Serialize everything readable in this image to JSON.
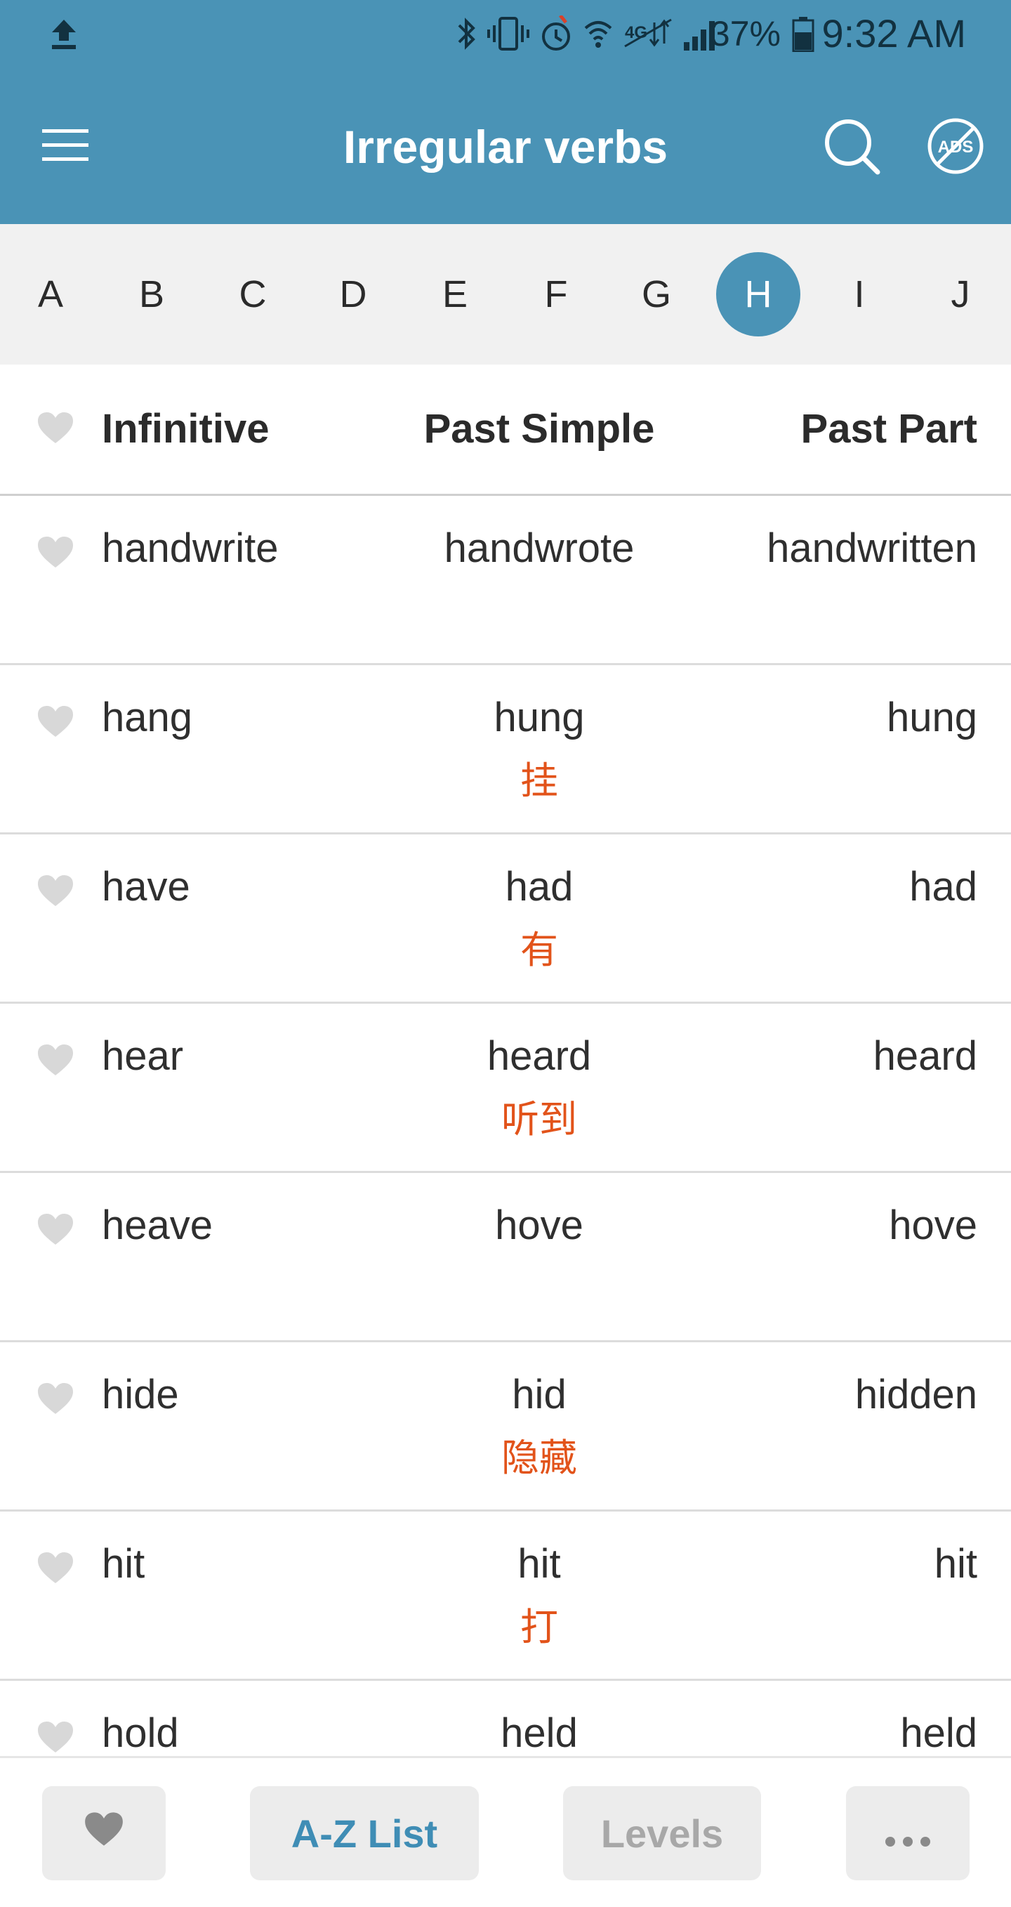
{
  "status_bar": {
    "upload_icon": "upload-arrow-icon",
    "icons": [
      "bluetooth-icon",
      "vibrate-icon",
      "alarm-icon",
      "wifi-icon",
      "lte-icon",
      "signal-icon"
    ],
    "battery_percent": "37%",
    "time": "9:32 AM"
  },
  "app_bar": {
    "title": "Irregular verbs",
    "menu_icon": "hamburger-menu-icon",
    "search_icon": "search-icon",
    "no_ads_icon": "no-ads-icon",
    "no_ads_text": "ADS",
    "background": "#4a93b6"
  },
  "alphabet": {
    "letters": [
      "A",
      "B",
      "C",
      "D",
      "E",
      "F",
      "G",
      "H",
      "I",
      "J"
    ],
    "selected": "H"
  },
  "table": {
    "headers": {
      "infinitive": "Infinitive",
      "past_simple": "Past Simple",
      "past_participle": "Past Part"
    },
    "rows": [
      {
        "infinitive": "handwrite",
        "past_simple": "handwrote",
        "past_participle": "handwritten",
        "translation": ""
      },
      {
        "infinitive": "hang",
        "past_simple": "hung",
        "past_participle": "hung",
        "translation": "挂"
      },
      {
        "infinitive": "have",
        "past_simple": "had",
        "past_participle": "had",
        "translation": "有"
      },
      {
        "infinitive": "hear",
        "past_simple": "heard",
        "past_participle": "heard",
        "translation": "听到"
      },
      {
        "infinitive": "heave",
        "past_simple": "hove",
        "past_participle": "hove",
        "translation": ""
      },
      {
        "infinitive": "hide",
        "past_simple": "hid",
        "past_participle": "hidden",
        "translation": "隐藏"
      },
      {
        "infinitive": "hit",
        "past_simple": "hit",
        "past_participle": "hit",
        "translation": "打"
      },
      {
        "infinitive": "hold",
        "past_simple": "held",
        "past_participle": "held",
        "translation": ""
      }
    ]
  },
  "bottom_bar": {
    "favorites_icon": "heart-icon",
    "az_list": "A-Z List",
    "levels": "Levels",
    "more_icon": "more-dots-icon"
  },
  "colors": {
    "accent": "#4a93b6",
    "translation": "#e2531a",
    "heart": "#d8d8d8"
  }
}
